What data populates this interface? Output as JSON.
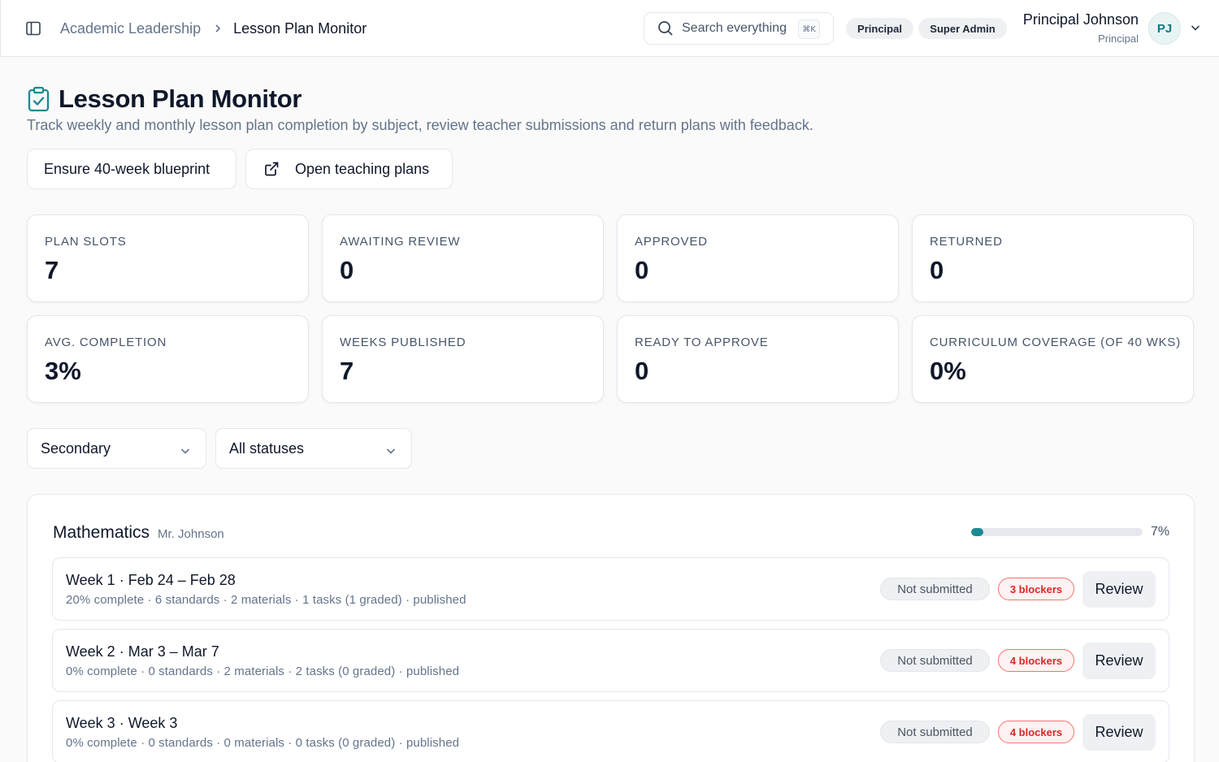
{
  "header": {
    "breadcrumb_parent": "Academic Leadership",
    "breadcrumb_current": "Lesson Plan Monitor",
    "search_label": "Search everything",
    "search_shortcut": "⌘K",
    "roles": [
      "Principal",
      "Super Admin"
    ],
    "user_name": "Principal Johnson",
    "user_role": "Principal",
    "avatar_initials": "PJ"
  },
  "page": {
    "title": "Lesson Plan Monitor",
    "description": "Track weekly and monthly lesson plan completion by subject, review teacher submissions and return plans with feedback.",
    "actions": {
      "blueprint_label": "Ensure 40-week blueprint",
      "open_plans_label": "Open teaching plans"
    }
  },
  "stats": [
    {
      "label": "PLAN SLOTS",
      "value": "7"
    },
    {
      "label": "AWAITING REVIEW",
      "value": "0"
    },
    {
      "label": "APPROVED",
      "value": "0"
    },
    {
      "label": "RETURNED",
      "value": "0"
    },
    {
      "label": "AVG. COMPLETION",
      "value": "3%"
    },
    {
      "label": "WEEKS PUBLISHED",
      "value": "7"
    },
    {
      "label": "READY TO APPROVE",
      "value": "0"
    },
    {
      "label": "CURRICULUM COVERAGE (OF 40 WKS)",
      "value": "0%"
    }
  ],
  "filters": {
    "level_selected": "Secondary",
    "status_selected": "All statuses"
  },
  "subject": {
    "name": "Mathematics",
    "teacher": "Mr. Johnson",
    "progress_percent": 7,
    "progress_label": "7%",
    "weeks": [
      {
        "title": "Week 1 · Feb 24 – Feb 28",
        "meta": "20% complete · 6 standards · 2 materials · 1 tasks (1 graded) · published",
        "status": "Not submitted",
        "blockers": "3 blockers",
        "action": "Review"
      },
      {
        "title": "Week 2 · Mar 3 – Mar 7",
        "meta": "0% complete · 0 standards · 2 materials · 2 tasks (0 graded) · published",
        "status": "Not submitted",
        "blockers": "4 blockers",
        "action": "Review"
      },
      {
        "title": "Week 3 · Week 3",
        "meta": "0% complete · 0 standards · 0 materials · 0 tasks (0 graded) · published",
        "status": "Not submitted",
        "blockers": "4 blockers",
        "action": "Review"
      }
    ]
  },
  "colors": {
    "accent": "#1a8a92",
    "progress_fill": "#1a8a92",
    "danger": "#dc2626"
  },
  "icons": {
    "sidebar_toggle": "sidebar-toggle-icon",
    "breadcrumb_separator": "chevron-right-icon",
    "search": "search-icon",
    "user_menu": "chevron-down-icon",
    "page_title": "clipboard-check-icon",
    "open_plans": "external-link-icon",
    "select": "chevron-down-icon"
  }
}
